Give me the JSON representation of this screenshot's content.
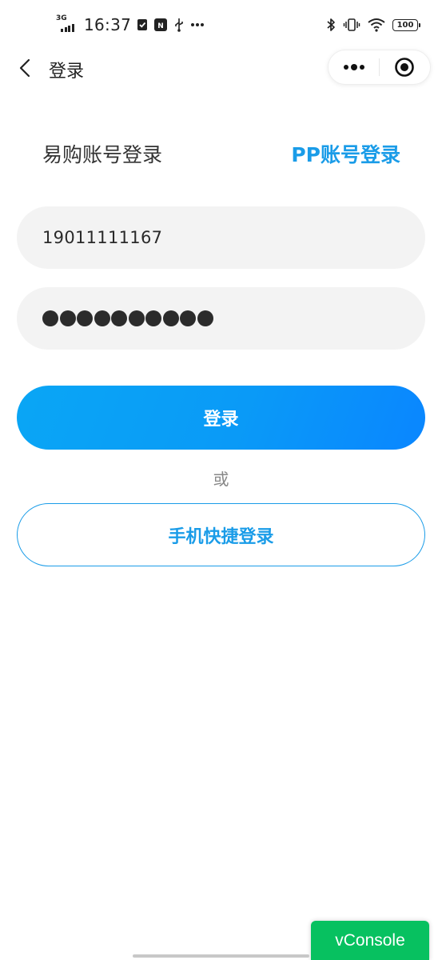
{
  "status_bar": {
    "network": "3G",
    "time": "16:37",
    "battery": "100",
    "icons": [
      "shield-check-icon",
      "nfc-icon",
      "usb-icon",
      "more-dots-icon",
      "bluetooth-icon",
      "vibrate-icon",
      "wifi-icon",
      "battery-icon"
    ]
  },
  "nav": {
    "title": "登录",
    "back_icon": "chevron-left-icon",
    "menu_icon": "more-dots-icon",
    "close_icon": "target-circle-icon"
  },
  "tabs": {
    "account": "易购账号登录",
    "pp": "PP账号登录"
  },
  "form": {
    "phone_value": "19011111167",
    "password_mask_count": 10
  },
  "buttons": {
    "login": "登录",
    "or": "或",
    "quick_login": "手机快捷登录"
  },
  "vconsole": {
    "label": "vConsole"
  },
  "colors": {
    "accent": "#1a9ce8",
    "button_gradient_start": "#0aa6f5",
    "button_gradient_end": "#0a86ff",
    "input_bg": "#f3f3f3",
    "vconsole_green": "#07c160"
  }
}
